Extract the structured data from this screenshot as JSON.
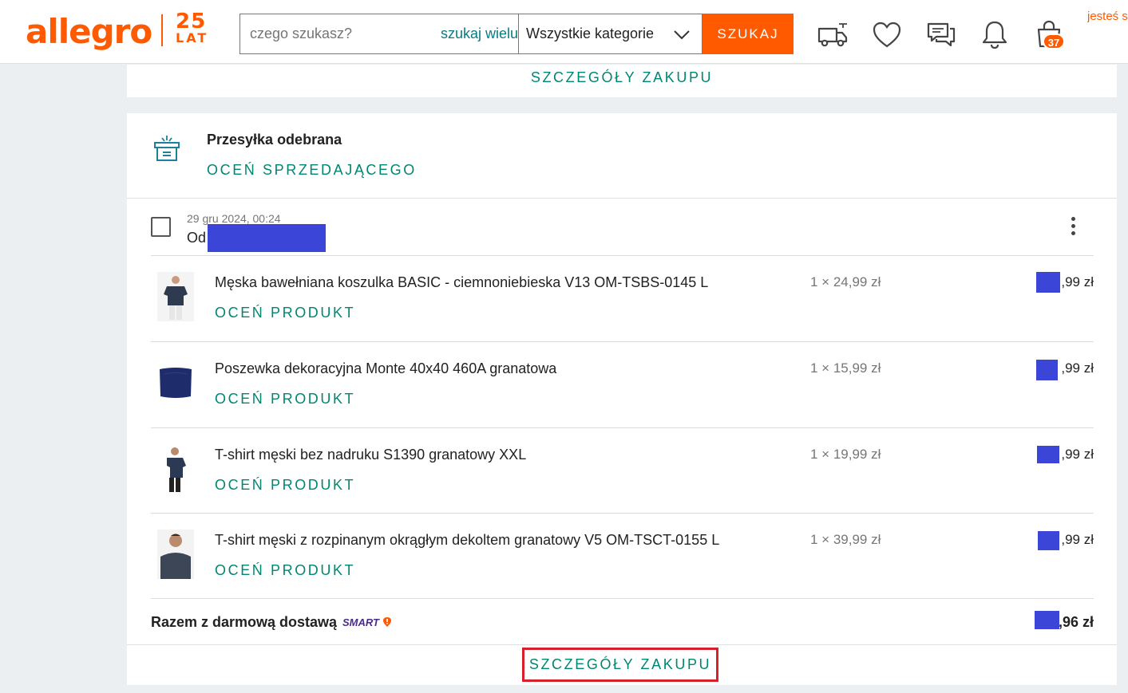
{
  "header": {
    "logo": "allegro",
    "logo_badge_number": "25",
    "logo_badge_text": "LAT",
    "search_placeholder": "czego szukasz?",
    "search_many": "szukaj wielu",
    "category": "Wszystkie kategorie",
    "search_button": "SZUKAJ",
    "cart_count": "37",
    "user_prompt": "jesteś s",
    "icons": [
      "delivery-truck-icon",
      "heart-icon",
      "messages-icon",
      "bell-icon",
      "shopping-bag-icon"
    ]
  },
  "top_panel": {
    "details_link": "SZCZEGÓŁY ZAKUPU"
  },
  "order": {
    "status": "Przesyłka odebrana",
    "rate_seller": "OCEŃ SPRZEDAJĄCEGO",
    "date": "29 gru 2024, 00:24",
    "from_label": "Od",
    "items": [
      {
        "name": "Męska bawełniana koszulka BASIC - ciemnoniebieska V13 OM-TSBS-0145 L",
        "qty": "1 × 24,99 zł",
        "price_suffix": ",99 zł",
        "rate": "OCEŃ PRODUKT"
      },
      {
        "name": "Poszewka dekoracyjna Monte 40x40 460A granatowa",
        "qty": "1 × 15,99 zł",
        "price_suffix": ",99 zł",
        "rate": "OCEŃ PRODUKT"
      },
      {
        "name": "T-shirt męski bez nadruku S1390 granatowy XXL",
        "qty": "1 × 19,99 zł",
        "price_suffix": ",99 zł",
        "rate": "OCEŃ PRODUKT"
      },
      {
        "name": "T-shirt męski z rozpinanym okrągłym dekoltem granatowy V5 OM-TSCT-0155 L",
        "qty": "1 × 39,99 zł",
        "price_suffix": ",99 zł",
        "rate": "OCEŃ PRODUKT"
      }
    ],
    "total_label": "Razem z darmową dostawą",
    "smart_label": "SMART",
    "total_suffix": ",96 zł",
    "details_link": "SZCZEGÓŁY ZAKUPU"
  },
  "colors": {
    "brand": "#ff5a00",
    "teal": "#008673",
    "redaction": "#3b45d8",
    "highlight": "#d6202a"
  }
}
